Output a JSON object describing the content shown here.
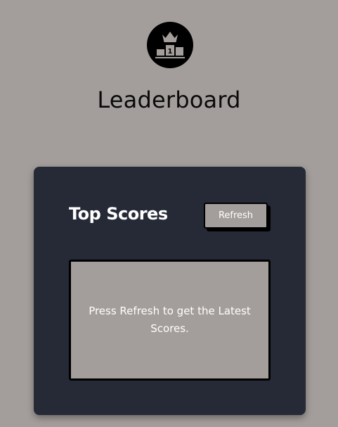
{
  "header": {
    "logo_icon": "podium-crown-icon",
    "podium_rank": "1",
    "title": "Leaderboard"
  },
  "card": {
    "title": "Top Scores",
    "refresh_label": "Refresh",
    "empty_message": "Press Refresh to get the Latest Scores."
  },
  "colors": {
    "background": "#a39e9b",
    "card": "#262a36",
    "logo": "#000000",
    "border": "#000000",
    "text_light": "#ffffff",
    "text_dark": "#0a0a0a"
  }
}
